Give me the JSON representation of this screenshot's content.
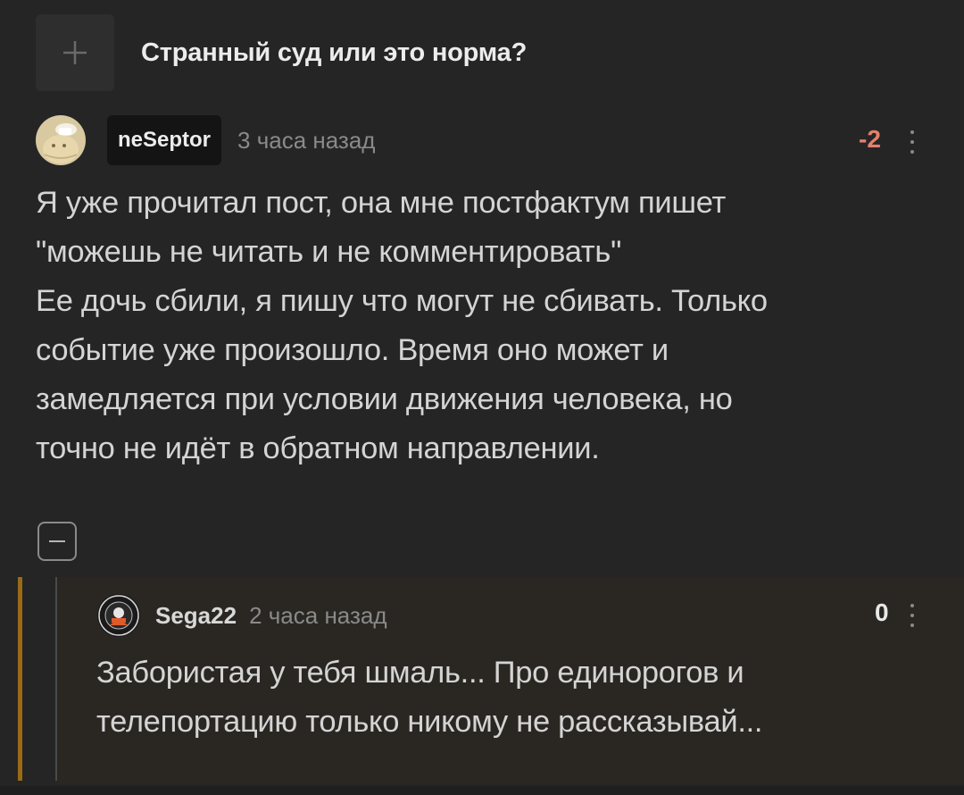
{
  "post": {
    "title": "Странный суд или это норма?",
    "expand_icon": "plus-icon"
  },
  "comment": {
    "username": "neSeptor",
    "timestamp": "3 часа назад",
    "rating": "-2",
    "rating_color": "#e4806b",
    "text": "Я уже прочитал пост, она мне постфактум пишет\n\"можешь не читать и не комментировать\"\nЕе дочь сбили, я пишу что могут не сбивать. Только\nсобытие уже произошло. Время оно может и\nзамедляется при условии движения человека, но\nточно не идёт в обратном направлении."
  },
  "collapse_icon": "minus-icon",
  "reply": {
    "username": "Sega22",
    "timestamp": "2 часа назад",
    "rating": "0",
    "rating_color": "#e8e8e8",
    "accent_color": "#9a6b14",
    "text": "Забористая у тебя шмаль... Про единорогов и\nтелепортацию только никому не рассказывай..."
  }
}
